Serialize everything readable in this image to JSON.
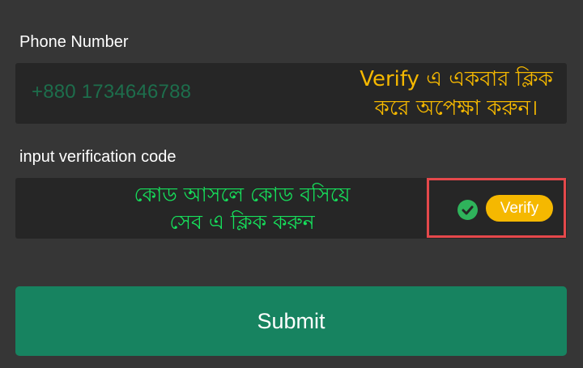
{
  "phone": {
    "label": "Phone Number",
    "value": "+880 1734646788",
    "annotation_line1": "Verify এ একবার ক্লিক",
    "annotation_line2": "করে অপেক্ষা করুন।"
  },
  "code": {
    "label": "input verification code",
    "annotation_line1": "কোড আসলে কোড বসিয়ে",
    "annotation_line2": "সেব এ ক্লিক করুন",
    "verify_label": "Verify",
    "status_icon": "check-circle-icon"
  },
  "submit": {
    "label": "Submit"
  },
  "colors": {
    "background": "#363636",
    "field": "#262626",
    "accent_green": "#178360",
    "verify_yellow": "#f5b800",
    "annotation_green": "#16e05b",
    "highlight_red": "#e5484b"
  }
}
